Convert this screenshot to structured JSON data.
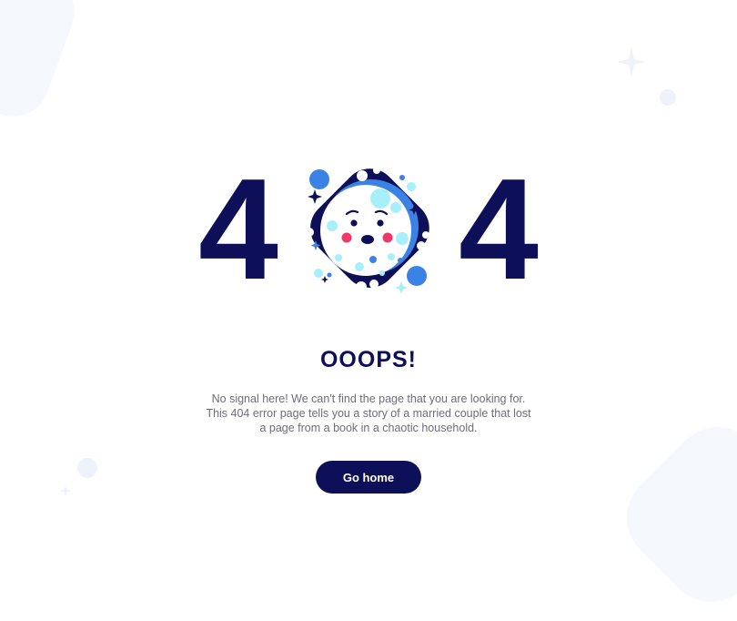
{
  "hero": {
    "digit_left": "4",
    "digit_right": "4"
  },
  "title": "OOOPS!",
  "message": {
    "line1": "No signal here! We can't find the page that you are looking for.",
    "line2": "This 404 error page tells you a story of a married couple that lost",
    "line3": "a page from a book in a chaotic household."
  },
  "button": {
    "label": "Go home"
  },
  "colors": {
    "navy": "#0e0f59",
    "text": "#6d6e78",
    "light_blue": "#a7f0fb",
    "blue": "#3b82e6",
    "cheek": "#f0386a"
  }
}
